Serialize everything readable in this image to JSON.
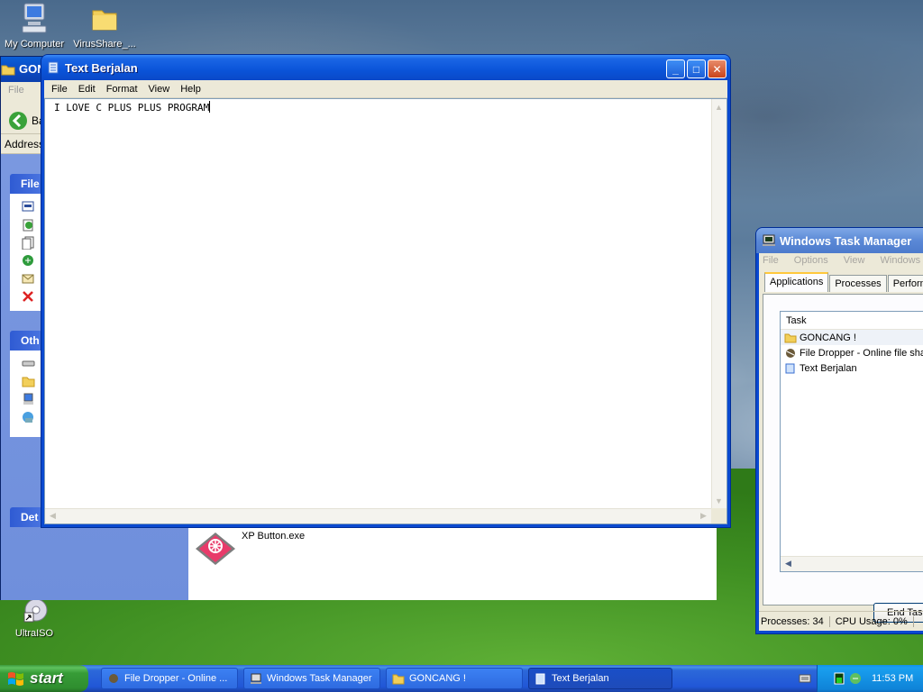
{
  "desktop": {
    "icons": [
      {
        "label": "My Computer"
      },
      {
        "label": "VirusShare_..."
      },
      {
        "label": "UltraISO"
      }
    ]
  },
  "explorer": {
    "title": "GON",
    "menu_file": "File",
    "back_label": "Ba",
    "address_label": "Address",
    "pane_file": "File",
    "pane_other": "Oth",
    "pane_details": "Det",
    "file_name": "XP Button.exe"
  },
  "notepad": {
    "title": "Text Berjalan",
    "menu": [
      "File",
      "Edit",
      "Format",
      "View",
      "Help"
    ],
    "content": "I LOVE C PLUS PLUS PROGRAM",
    "btn_min": "_",
    "btn_max": "□",
    "btn_close": "✕"
  },
  "taskmgr": {
    "title": "Windows Task Manager",
    "menu": [
      "File",
      "Options",
      "View",
      "Windows",
      "He"
    ],
    "tabs": [
      "Applications",
      "Processes",
      "Performa"
    ],
    "column_task": "Task",
    "tasks": [
      "GONCANG !",
      "File Dropper - Online file sha",
      "Text Berjalan"
    ],
    "end_task": "End Tas",
    "status_processes": "Processes: 34",
    "status_cpu": "CPU Usage: 0%"
  },
  "taskbar": {
    "start_label": "start",
    "buttons": [
      {
        "label": "File Dropper - Online ..."
      },
      {
        "label": "Windows Task Manager"
      },
      {
        "label": "GONCANG !"
      },
      {
        "label": "Text Berjalan"
      }
    ],
    "clock": "11:53 PM"
  },
  "icons": {
    "my_computer": "computer-icon",
    "folder": "folder-icon",
    "ultraiso": "disc-icon",
    "notepad": "notepad-icon",
    "taskmgr": "task-manager-icon",
    "xp_button": "xp-button-icon"
  }
}
